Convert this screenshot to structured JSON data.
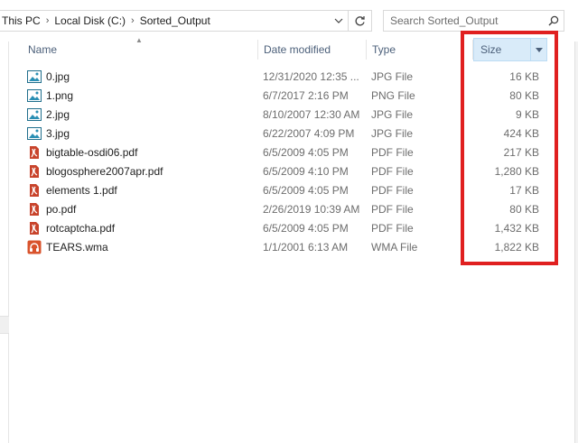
{
  "breadcrumb": {
    "items": [
      "This PC",
      "Local Disk (C:)",
      "Sorted_Output"
    ],
    "separator": "›"
  },
  "search": {
    "placeholder": "Search Sorted_Output"
  },
  "columns": {
    "name": "Name",
    "date": "Date modified",
    "type": "Type",
    "size": "Size"
  },
  "files": [
    {
      "name": "0.jpg",
      "date": "12/31/2020 12:35 ...",
      "type": "JPG File",
      "size": "16 KB",
      "icon": "image-file-icon"
    },
    {
      "name": "1.png",
      "date": "6/7/2017 2:16 PM",
      "type": "PNG File",
      "size": "80 KB",
      "icon": "image-file-icon"
    },
    {
      "name": "2.jpg",
      "date": "8/10/2007 12:30 AM",
      "type": "JPG File",
      "size": "9 KB",
      "icon": "image-file-icon"
    },
    {
      "name": "3.jpg",
      "date": "6/22/2007 4:09 PM",
      "type": "JPG File",
      "size": "424 KB",
      "icon": "image-file-icon"
    },
    {
      "name": "bigtable-osdi06.pdf",
      "date": "6/5/2009 4:05 PM",
      "type": "PDF File",
      "size": "217 KB",
      "icon": "pdf-file-icon"
    },
    {
      "name": "blogosphere2007apr.pdf",
      "date": "6/5/2009 4:10 PM",
      "type": "PDF File",
      "size": "1,280 KB",
      "icon": "pdf-file-icon"
    },
    {
      "name": "elements 1.pdf",
      "date": "6/5/2009 4:05 PM",
      "type": "PDF File",
      "size": "17 KB",
      "icon": "pdf-file-icon"
    },
    {
      "name": "po.pdf",
      "date": "2/26/2019 10:39 AM",
      "type": "PDF File",
      "size": "80 KB",
      "icon": "pdf-file-icon"
    },
    {
      "name": "rotcaptcha.pdf",
      "date": "6/5/2009 4:05 PM",
      "type": "PDF File",
      "size": "1,432 KB",
      "icon": "pdf-file-icon"
    },
    {
      "name": "TEARS.wma",
      "date": "1/1/2001 6:13 AM",
      "type": "WMA File",
      "size": "1,822 KB",
      "icon": "audio-file-icon"
    }
  ],
  "colors": {
    "annotation": "#e02020",
    "header_text": "#4c607a",
    "size_header_highlight": "#d9ebf9"
  }
}
